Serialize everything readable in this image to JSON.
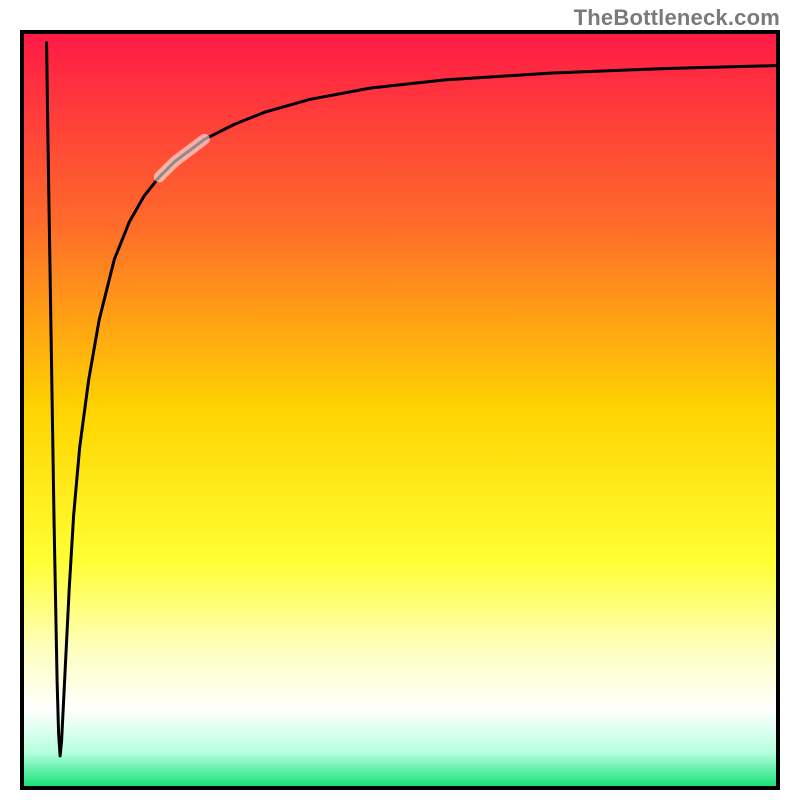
{
  "watermark": "TheBottleneck.com",
  "chart_data": {
    "type": "line",
    "title": "",
    "xlabel": "",
    "ylabel": "",
    "xlim": [
      0,
      100
    ],
    "ylim": [
      0,
      100
    ],
    "grid": false,
    "legend": false,
    "gradient_stops": [
      {
        "pos": 0.0,
        "color": "#ff1a46"
      },
      {
        "pos": 0.25,
        "color": "#ff6a2b"
      },
      {
        "pos": 0.5,
        "color": "#ffd400"
      },
      {
        "pos": 0.7,
        "color": "#ffff33"
      },
      {
        "pos": 0.82,
        "color": "#fdffbf"
      },
      {
        "pos": 0.9,
        "color": "#ffffff"
      },
      {
        "pos": 0.955,
        "color": "#b6ffdf"
      },
      {
        "pos": 1.0,
        "color": "#19e27a"
      }
    ],
    "series": [
      {
        "name": "curve",
        "x": [
          3.0,
          3.2,
          3.6,
          4.0,
          4.4,
          4.6,
          4.8,
          5.0,
          5.4,
          6.0,
          6.6,
          7.4,
          8.6,
          10,
          12,
          14,
          16,
          18,
          20,
          24,
          28,
          32,
          38,
          46,
          56,
          70,
          85,
          100
        ],
        "y": [
          99,
          85,
          60,
          35,
          14,
          7,
          4,
          6,
          14,
          26,
          36,
          45,
          54,
          62,
          70,
          75,
          78.5,
          81,
          83,
          86,
          88,
          89.6,
          91.3,
          92.8,
          93.9,
          94.8,
          95.4,
          95.8
        ]
      }
    ],
    "highlight_segment": {
      "x_start": 18,
      "x_end": 24
    }
  }
}
